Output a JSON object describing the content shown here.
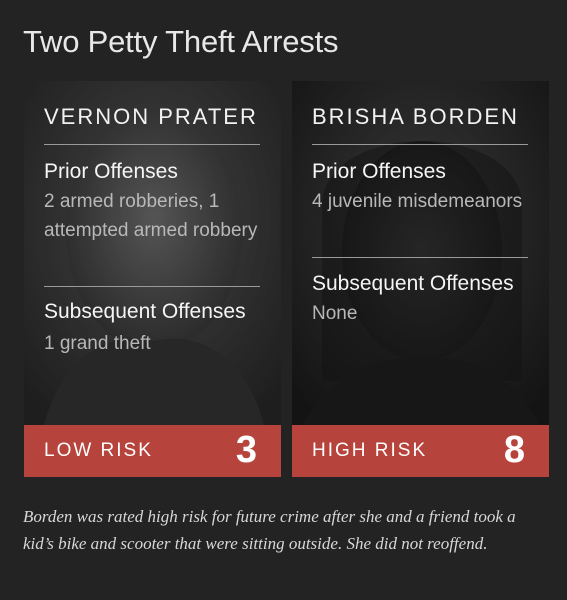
{
  "title": "Two Petty Theft Arrests",
  "cards": [
    {
      "name": "VERNON PRATER",
      "prior_label": "Prior Offenses",
      "prior_value": "2 armed robberies, 1 attempted armed robbery",
      "subsequent_label": "Subsequent Offenses",
      "subsequent_value": "1 grand theft",
      "risk_label": "LOW RISK",
      "risk_score": "3"
    },
    {
      "name": "BRISHA BORDEN",
      "prior_label": "Prior Offenses",
      "prior_value": "4 juvenile misdemeanors",
      "subsequent_label": "Subsequent Offenses",
      "subsequent_value": "None",
      "risk_label": "HIGH RISK",
      "risk_score": "8"
    }
  ],
  "caption": "Borden was rated high risk for future crime after she and a friend took a kid’s bike and scooter that were sitting outside. She did not reoffend.",
  "colors": {
    "background": "#232323",
    "risk_bar": "#b7443c"
  }
}
